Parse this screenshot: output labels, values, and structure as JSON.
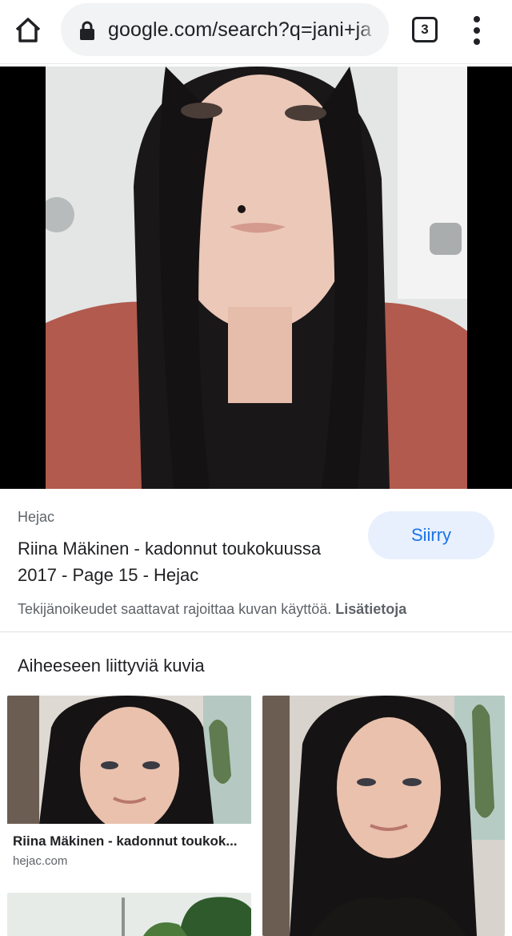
{
  "browser": {
    "url": "google.com/search?q=jani+ja",
    "tab_count": "3",
    "icons": [
      "home-icon",
      "lock-icon",
      "tab-switcher-icon",
      "more-vert-icon"
    ]
  },
  "result": {
    "source": "Hejac",
    "title": "Riina Mäkinen - kadonnut toukokuussa 2017 - Page 15 - Hejac",
    "go_label": "Siirry",
    "copyright_text": "Tekijänoikeudet saattavat rajoittaa kuvan käyttöä.",
    "learn_more": "Lisätietoja"
  },
  "related": {
    "heading": "Aiheeseen liittyviä kuvia",
    "items": [
      {
        "title": "Riina Mäkinen - kadonnut toukok...",
        "domain": "hejac.com"
      }
    ]
  },
  "colors": {
    "accent": "#1a73e8",
    "accent_bg": "#e8f0fe",
    "urlbar_bg": "#f1f3f4",
    "viewer_bg": "#000000"
  }
}
